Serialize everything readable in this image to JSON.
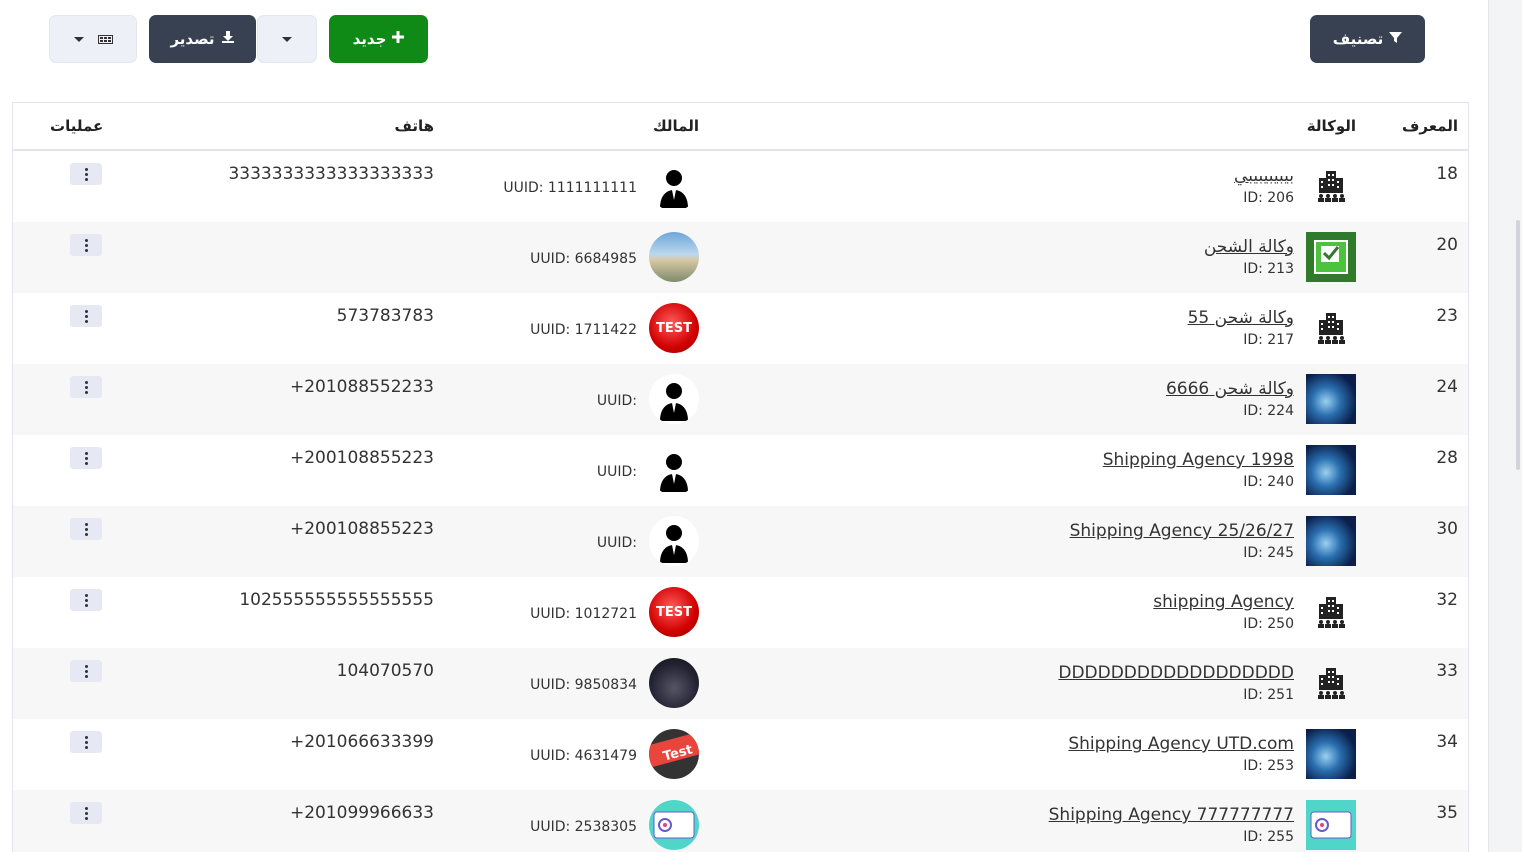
{
  "toolbar": {
    "filter_label": "تصنيف",
    "new_label": "جديد",
    "export_label": "تصدير"
  },
  "table": {
    "headers": {
      "id": "المعرف",
      "agency": "الوكالة",
      "owner": "المالك",
      "phone": "هاتف",
      "actions": "عمليات"
    },
    "rows": [
      {
        "id": "18",
        "agency_name": "بيبيبيبيبي",
        "agency_id": "ID: 206",
        "agency_icon": "building-icon",
        "uuid": "UUID: 1111111111",
        "avatar": "silhouette-avatar",
        "phone": "3333333333333333333"
      },
      {
        "id": "20",
        "agency_name": "وكالة الشحن",
        "agency_id": "ID: 213",
        "agency_icon": "testing-check-icon",
        "uuid": "UUID: 6684985",
        "avatar": "beach-photo-avatar",
        "phone": ""
      },
      {
        "id": "23",
        "agency_name": "وكالة شحن 55",
        "agency_id": "ID: 217",
        "agency_icon": "building-icon",
        "uuid": "UUID: 1711422",
        "avatar": "test-button-avatar",
        "phone": "573783783"
      },
      {
        "id": "24",
        "agency_name": "وكالة شحن 6666",
        "agency_id": "ID: 224",
        "agency_icon": "tech-globe-icon",
        "uuid": "UUID:",
        "avatar": "silhouette-avatar",
        "phone": "+201088552233"
      },
      {
        "id": "28",
        "agency_name": "Shipping Agency 1998",
        "agency_id": "ID: 240",
        "agency_icon": "tech-globe-icon",
        "uuid": "UUID:",
        "avatar": "silhouette-avatar",
        "phone": "+200108855223"
      },
      {
        "id": "30",
        "agency_name": "Shipping Agency 25/26/27",
        "agency_id": "ID: 245",
        "agency_icon": "tech-globe-icon",
        "uuid": "UUID:",
        "avatar": "silhouette-avatar",
        "phone": "+200108855223"
      },
      {
        "id": "32",
        "agency_name": "shipping Agency",
        "agency_id": "ID: 250",
        "agency_icon": "building-icon",
        "uuid": "UUID: 1012721",
        "avatar": "test-button-avatar",
        "phone": "102555555555555555"
      },
      {
        "id": "33",
        "agency_name": "DDDDDDDDDDDDDDDDDD",
        "agency_id": "ID: 251",
        "agency_icon": "building-icon",
        "uuid": "UUID: 9850834",
        "avatar": "night-photo-avatar",
        "phone": "104070570"
      },
      {
        "id": "34",
        "agency_name": "Shipping Agency UTD.com",
        "agency_id": "ID: 253",
        "agency_icon": "tech-globe-icon",
        "uuid": "UUID: 4631479",
        "avatar": "test-tag-avatar",
        "phone": "+201066633399"
      },
      {
        "id": "35",
        "agency_name": "Shipping Agency 777777777",
        "agency_id": "ID: 255",
        "agency_icon": "teal-card-icon",
        "uuid": "UUID: 2538305",
        "avatar": "teal-card-avatar",
        "phone": "+201099966633"
      }
    ]
  },
  "colors": {
    "dark_button": "#374151",
    "green_button": "#0f8a16",
    "light_button": "#eef0f8",
    "row_alt": "#f7f7f7"
  }
}
